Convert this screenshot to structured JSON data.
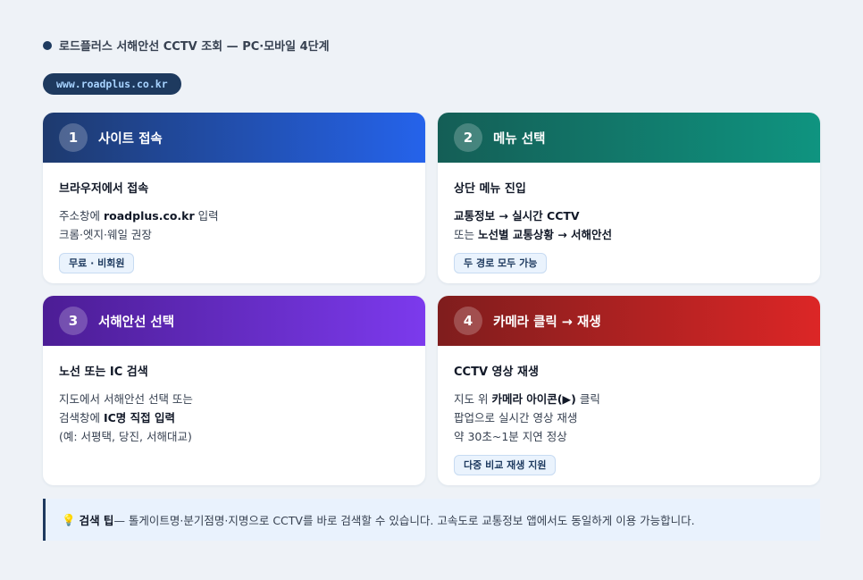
{
  "header": {
    "title": "로드플러스 서해안선 CCTV 조회 — PC·모바일 4단계"
  },
  "url": "www.roadplus.co.kr",
  "steps": [
    {
      "number": "1",
      "title": "사이트 접속",
      "body_title": "브라우저에서 접속",
      "line1_pre": "주소창에 ",
      "line1_bold": "roadplus.co.kr",
      "line1_post": " 입력",
      "line2": "크롬·엣지·웨일 권장",
      "tag": "무료 · 비회원"
    },
    {
      "number": "2",
      "title": "메뉴 선택",
      "body_title": "상단 메뉴 진입",
      "line1_bold": "교통정보 → 실시간 CCTV",
      "line2_pre": "또는 ",
      "line2_bold": "노선별 교통상황 → 서해안선",
      "tag": "두 경로 모두 가능"
    },
    {
      "number": "3",
      "title": "서해안선 선택",
      "body_title": "노선 또는 IC 검색",
      "line1": "지도에서 서해안선 선택 또는",
      "line2_pre": "검색창에 ",
      "line2_bold": "IC명 직접 입력",
      "line3": "(예: 서평택, 당진, 서해대교)"
    },
    {
      "number": "4",
      "title": "카메라 클릭 → 재생",
      "body_title": "CCTV 영상 재생",
      "line1_pre": "지도 위 ",
      "line1_bold": "카메라 아이콘(▶)",
      "line1_post": " 클릭",
      "line2": "팝업으로 실시간 영상 재생",
      "line3": "약 30초~1분 지연 정상",
      "tag": "다중 비교 재생 지원"
    }
  ],
  "tip": {
    "icon": "💡",
    "label": "검색 팁",
    "text": " — 톨게이트명·분기점명·지명으로 CCTV를 바로 검색할 수 있습니다. 고속도로 교통정보 앱에서도 동일하게 이용 가능합니다."
  },
  "colors": {
    "background": "#eef2f7",
    "navy": "#1e3a5f",
    "step1": "#2563eb",
    "step2": "#0f9480",
    "step3": "#7c3aed",
    "step4": "#dc2626"
  }
}
